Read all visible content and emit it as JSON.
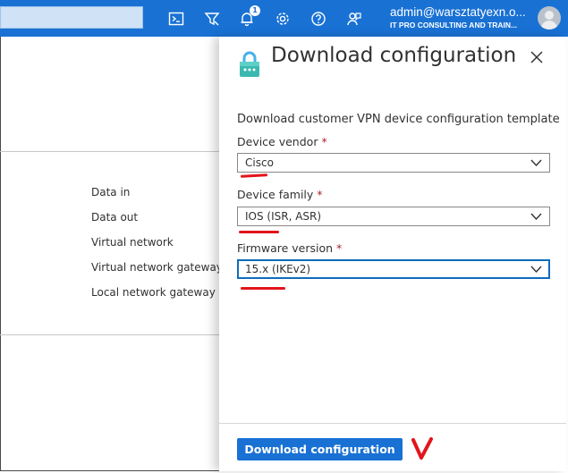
{
  "topbar": {
    "notification_count": "1",
    "account_email": "admin@warsztatyexn.o...",
    "account_org": "IT PRO CONSULTING AND TRAIN...",
    "icons": [
      "cloud-shell-icon",
      "directory-filter-icon",
      "notifications-icon",
      "settings-icon",
      "help-icon",
      "feedback-icon"
    ],
    "background_color": "#1971d4"
  },
  "background_blade": {
    "labels": [
      "Data in",
      "Data out",
      "Virtual network",
      "Virtual network gateway",
      "Local network gateway"
    ]
  },
  "panel": {
    "title": "Download configuration",
    "description": "Download customer VPN device configuration template",
    "fields": [
      {
        "label": "Device vendor",
        "required_mark": "*",
        "value": "Cisco"
      },
      {
        "label": "Device family",
        "required_mark": "*",
        "value": "IOS (ISR, ASR)"
      },
      {
        "label": "Firmware version",
        "required_mark": "*",
        "value": "15.x (IKEv2)"
      }
    ],
    "primary_button": "Download configuration",
    "accent_color": "#1971d4",
    "annotation_color": "#e3141b"
  }
}
